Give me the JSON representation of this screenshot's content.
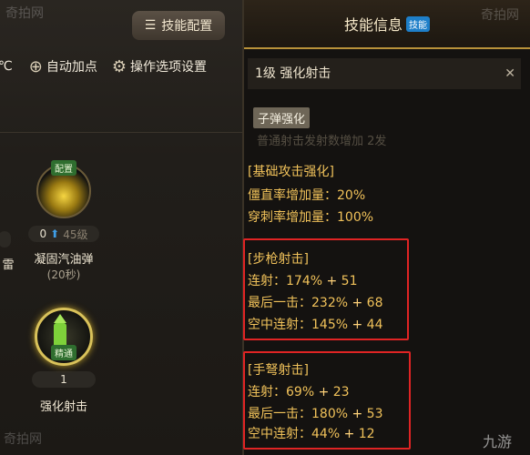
{
  "left": {
    "skill_config_label": "技能配置",
    "auto_points_label": "自动加点",
    "settings_label": "操作选项设置",
    "partial_label": "雷",
    "skills": [
      {
        "tag": "配置",
        "level": "0",
        "max": "45级",
        "name": "凝固汽油弹",
        "sub": "(20秒)"
      },
      {
        "tag": "精通",
        "level": "1",
        "name": "强化射击"
      }
    ]
  },
  "right": {
    "header_title": "技能信息",
    "header_badge": "技能",
    "skill_title": "1级 强化射击",
    "chip": "子弹强化",
    "faded_line": "普通射击发射数增加 2发",
    "section_base": "[基础攻击强化]",
    "stiff_label": "僵直率增加量：",
    "stiff_value": "20%",
    "pierce_label": "穿刺率增加量：",
    "pierce_value": "100%",
    "rifle": {
      "title": "[步枪射击]",
      "rows": [
        {
          "label": "连射：",
          "pct": "174%",
          "plus": " + ",
          "add": "51"
        },
        {
          "label": "最后一击：",
          "pct": "232%",
          "plus": " + ",
          "add": "68"
        },
        {
          "label": "空中连射：",
          "pct": "145%",
          "plus": " + ",
          "add": "44"
        }
      ]
    },
    "crossbow": {
      "title": "[手弩射击]",
      "rows": [
        {
          "label": "连射：",
          "pct": "69%",
          "plus": " + ",
          "add": "23"
        },
        {
          "label": "最后一击：",
          "pct": "180%",
          "plus": " + ",
          "add": "53"
        },
        {
          "label": "空中连射：",
          "pct": "44%",
          "plus": " + ",
          "add": "12"
        }
      ]
    }
  },
  "watermarks": {
    "top_left": "奇拍网",
    "top_right": "奇拍网",
    "bottom_left": "奇拍网",
    "bottom_right": "九游"
  }
}
